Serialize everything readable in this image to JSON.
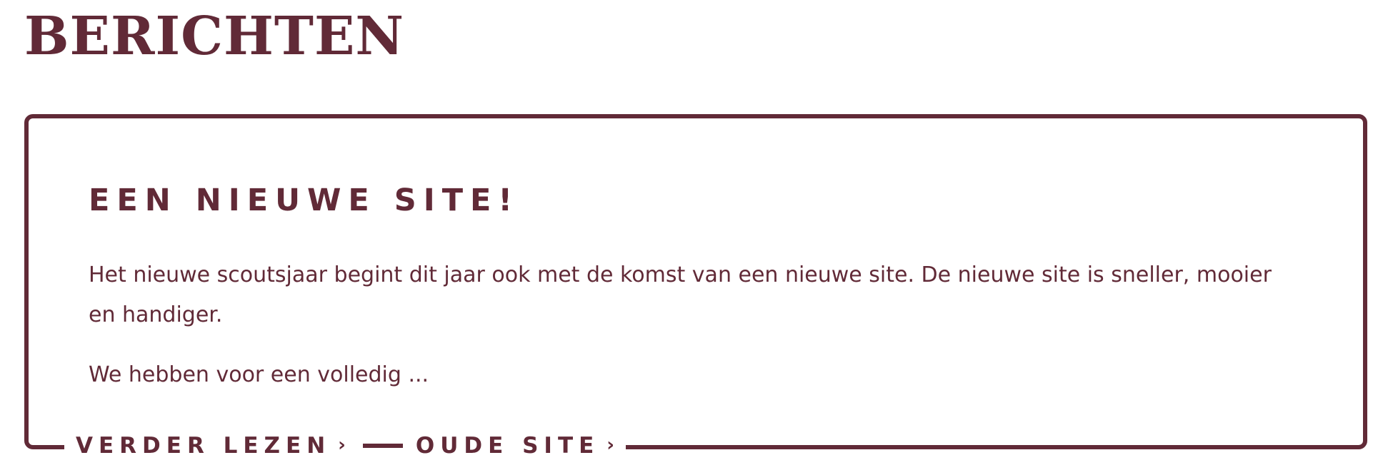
{
  "page": {
    "heading": "BERICHTEN"
  },
  "post": {
    "title": "EEN NIEUWE SITE!",
    "excerpt": [
      "Het nieuwe scoutsjaar begint dit jaar ook met de komst van een nieuwe site. De nieuwe site is sneller, mooier en handiger.",
      "We hebben voor een volledig ..."
    ],
    "actions": {
      "read_more_label": "VERDER LEZEN",
      "old_site_label": "OUDE SITE",
      "chevron_glyph": "›"
    }
  },
  "colors": {
    "accent": "#612a37",
    "background": "#ffffff"
  },
  "icons": {
    "link_arrow": "chevron-right-icon"
  }
}
